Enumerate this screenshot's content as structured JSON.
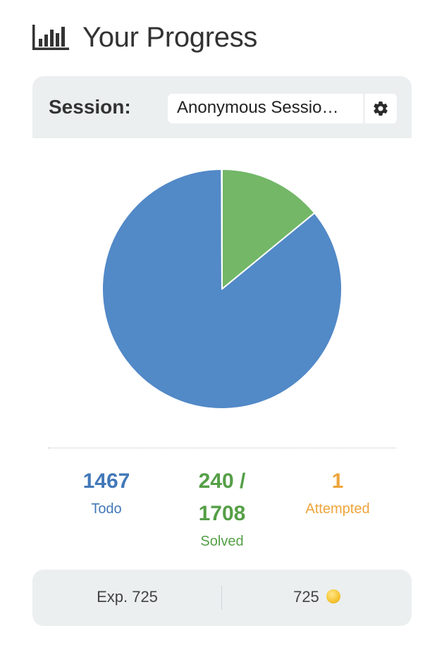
{
  "header": {
    "title": "Your Progress",
    "icon": "bar-chart-icon"
  },
  "session": {
    "label": "Session:",
    "selected": "Anonymous Sessio…",
    "settings_icon": "gear-icon"
  },
  "chart_data": {
    "type": "pie",
    "slices": [
      {
        "label": "Solved",
        "value": 240,
        "color": "#73b767"
      },
      {
        "label": "Todo",
        "value": 1467,
        "color": "#5289c7"
      },
      {
        "label": "Attempted",
        "value": 1,
        "color": "#eea43b"
      }
    ]
  },
  "stats": {
    "todo": {
      "value": "1467",
      "label": "Todo",
      "color": "#4278b8"
    },
    "solved": {
      "value": "240 /",
      "total": "1708",
      "label": "Solved",
      "color": "#559f47"
    },
    "attempted": {
      "value": "1",
      "label": "Attempted",
      "color": "#eea43b"
    }
  },
  "footer": {
    "exp": "Exp. 725",
    "coins": "725",
    "coin_icon": "coin-icon"
  }
}
